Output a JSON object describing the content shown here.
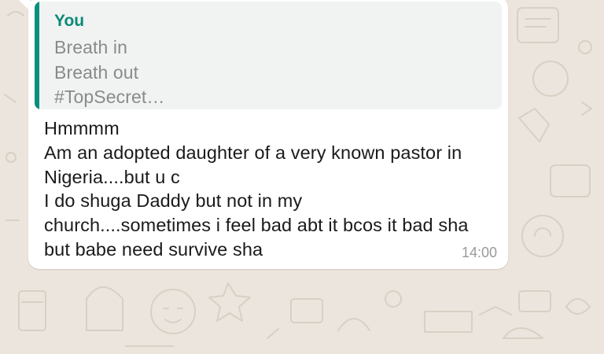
{
  "quoted": {
    "author": "You",
    "lines": [
      "Breath in",
      "Breath out",
      "#TopSecret…"
    ]
  },
  "message": {
    "lines": [
      "Hmmmm",
      "Am an adopted daughter of a very known pastor in",
      "Nigeria....but u c",
      "I do shuga Daddy but not in my",
      "church....sometimes i feel bad abt it bcos it bad sha",
      "but babe need survive sha"
    ],
    "time": "14:00"
  },
  "colors": {
    "wallpaper": "#ece5dd",
    "accent": "#06907e",
    "bubble": "#ffffff"
  }
}
